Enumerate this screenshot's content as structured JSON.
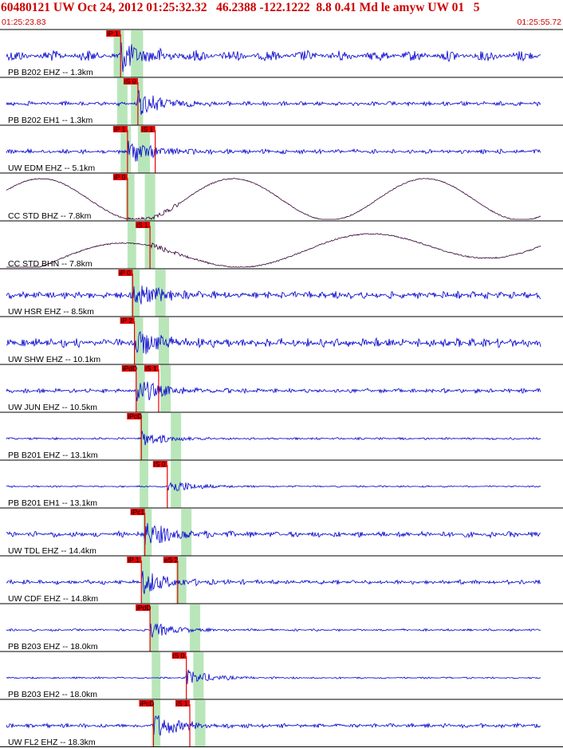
{
  "header": {
    "title": "60480121 UW Oct 24, 2012 01:25:32.32   46.2388 -122.1222  8.8 0.41 Md le amyw UW 01   5",
    "time_start": "01:25:23.83",
    "time_end": "01:25:55.72"
  },
  "colors": {
    "header_red": "#cc0000",
    "trace_blue": "#0000cc",
    "trace_dark": "#330033",
    "pick_red": "#e60000",
    "pick_window_green": "#b9e6b9",
    "panel_border": "#000000"
  },
  "time_range": {
    "start": 0,
    "end": 31.89
  },
  "traces": [
    {
      "label": "PB B202 EHZ -- 1.3km",
      "color": "blue",
      "style": "noise",
      "amp": 7,
      "freq": 3.0,
      "shade": [
        [
          6.2,
          6.8
        ],
        [
          7.2,
          7.9
        ]
      ],
      "picks": [
        {
          "t": 6.6,
          "label": "iP 1"
        }
      ]
    },
    {
      "label": "PB B202 EH1 -- 1.3km",
      "color": "blue",
      "style": "noise",
      "amp": 3,
      "freq": 6.0,
      "shade": [
        [
          6.4,
          7.0
        ],
        [
          7.2,
          7.9
        ]
      ],
      "picks": [
        {
          "t": 7.6,
          "label": "iS 0"
        }
      ]
    },
    {
      "label": "UW EDM EHZ -- 5.1km",
      "color": "blue",
      "style": "noise",
      "amp": 3,
      "freq": 6.0,
      "shade": [
        [
          6.6,
          7.2
        ],
        [
          7.6,
          8.3
        ]
      ],
      "picks": [
        {
          "t": 7.0,
          "label": "iP 1"
        },
        {
          "t": 8.6,
          "label": "iS 1"
        }
      ]
    },
    {
      "label": "CC STD BHZ -- 7.8km",
      "color": "dark",
      "style": "wave",
      "amp": 26,
      "freq": 0.09,
      "shade": [
        [
          6.9,
          7.4
        ],
        [
          8.0,
          8.6
        ]
      ],
      "picks": [
        {
          "t": 7.0,
          "label": "iP 0"
        }
      ]
    },
    {
      "label": "CC STD BHN -- 7.8km",
      "color": "dark",
      "style": "drift",
      "amp": 18,
      "freq": 0.07,
      "shade": [
        [
          7.0,
          7.5
        ],
        [
          8.0,
          8.6
        ]
      ],
      "picks": [
        {
          "t": 8.3,
          "label": "iS 1"
        }
      ]
    },
    {
      "label": "UW HSR EHZ -- 8.5km",
      "color": "blue",
      "style": "noise",
      "amp": 5,
      "freq": 8.0,
      "shade": [
        [
          7.2,
          7.7
        ],
        [
          8.6,
          9.2
        ]
      ],
      "picks": [
        {
          "t": 7.3,
          "label": "iP 0"
        }
      ]
    },
    {
      "label": "UW SHW EHZ -- 10.1km",
      "color": "blue",
      "style": "noise",
      "amp": 6,
      "freq": 8.0,
      "shade": [
        [
          7.4,
          7.9
        ],
        [
          8.8,
          9.4
        ]
      ],
      "picks": [
        {
          "t": 7.4,
          "label": "iP 2"
        }
      ]
    },
    {
      "label": "UW JUN EHZ -- 10.5km",
      "color": "blue",
      "style": "noise",
      "amp": 3,
      "freq": 7.0,
      "shade": [
        [
          7.5,
          8.0
        ],
        [
          8.9,
          9.5
        ]
      ],
      "picks": [
        {
          "t": 7.5,
          "label": "iPdD"
        },
        {
          "t": 8.8,
          "label": "iS 1"
        }
      ]
    },
    {
      "label": "PB B201 EHZ -- 13.1km",
      "color": "blue",
      "style": "flat",
      "amp": 1.5,
      "freq": 5.0,
      "shade": [
        [
          7.7,
          8.2
        ],
        [
          9.5,
          10.1
        ]
      ],
      "picks": [
        {
          "t": 7.8,
          "label": "iPcD"
        }
      ]
    },
    {
      "label": "PB B201 EH1 -- 13.1km",
      "color": "blue",
      "style": "flat",
      "amp": 1.2,
      "freq": 5.0,
      "shade": [
        [
          7.7,
          8.2
        ],
        [
          9.5,
          10.1
        ]
      ],
      "picks": [
        {
          "t": 9.3,
          "label": "iS 0"
        }
      ]
    },
    {
      "label": "UW TDL EHZ -- 14.4km",
      "color": "blue",
      "style": "noise",
      "amp": 4,
      "freq": 5.0,
      "shade": [
        [
          7.9,
          8.4
        ],
        [
          10.1,
          10.7
        ]
      ],
      "picks": [
        {
          "t": 8.0,
          "label": "iPc1"
        }
      ]
    },
    {
      "label": "UW CDF EHZ -- 14.8km",
      "color": "blue",
      "style": "noise",
      "amp": 3,
      "freq": 7.0,
      "shade": [
        [
          7.8,
          8.3
        ],
        [
          9.8,
          10.4
        ]
      ],
      "picks": [
        {
          "t": 7.8,
          "label": "iP 1"
        },
        {
          "t": 9.9,
          "label": "eS 2"
        }
      ]
    },
    {
      "label": "PB B203 EHZ -- 18.0km",
      "color": "blue",
      "style": "flat",
      "amp": 1.5,
      "freq": 5.0,
      "shade": [
        [
          8.3,
          8.8
        ],
        [
          10.6,
          11.2
        ]
      ],
      "picks": [
        {
          "t": 8.3,
          "label": "iPdD"
        }
      ]
    },
    {
      "label": "PB B203 EH2 -- 18.0km",
      "color": "blue",
      "style": "flat",
      "amp": 1.2,
      "freq": 5.0,
      "shade": [
        [
          8.4,
          8.9
        ],
        [
          10.8,
          11.4
        ]
      ],
      "picks": [
        {
          "t": 10.4,
          "label": "iS 0"
        }
      ]
    },
    {
      "label": "UW FL2 EHZ -- 18.3km",
      "color": "blue",
      "style": "noise",
      "amp": 3,
      "freq": 6.0,
      "shade": [
        [
          8.4,
          8.9
        ],
        [
          10.9,
          11.5
        ]
      ],
      "picks": [
        {
          "t": 8.5,
          "label": "iPcD"
        },
        {
          "t": 10.6,
          "label": "iS 1"
        }
      ]
    }
  ]
}
